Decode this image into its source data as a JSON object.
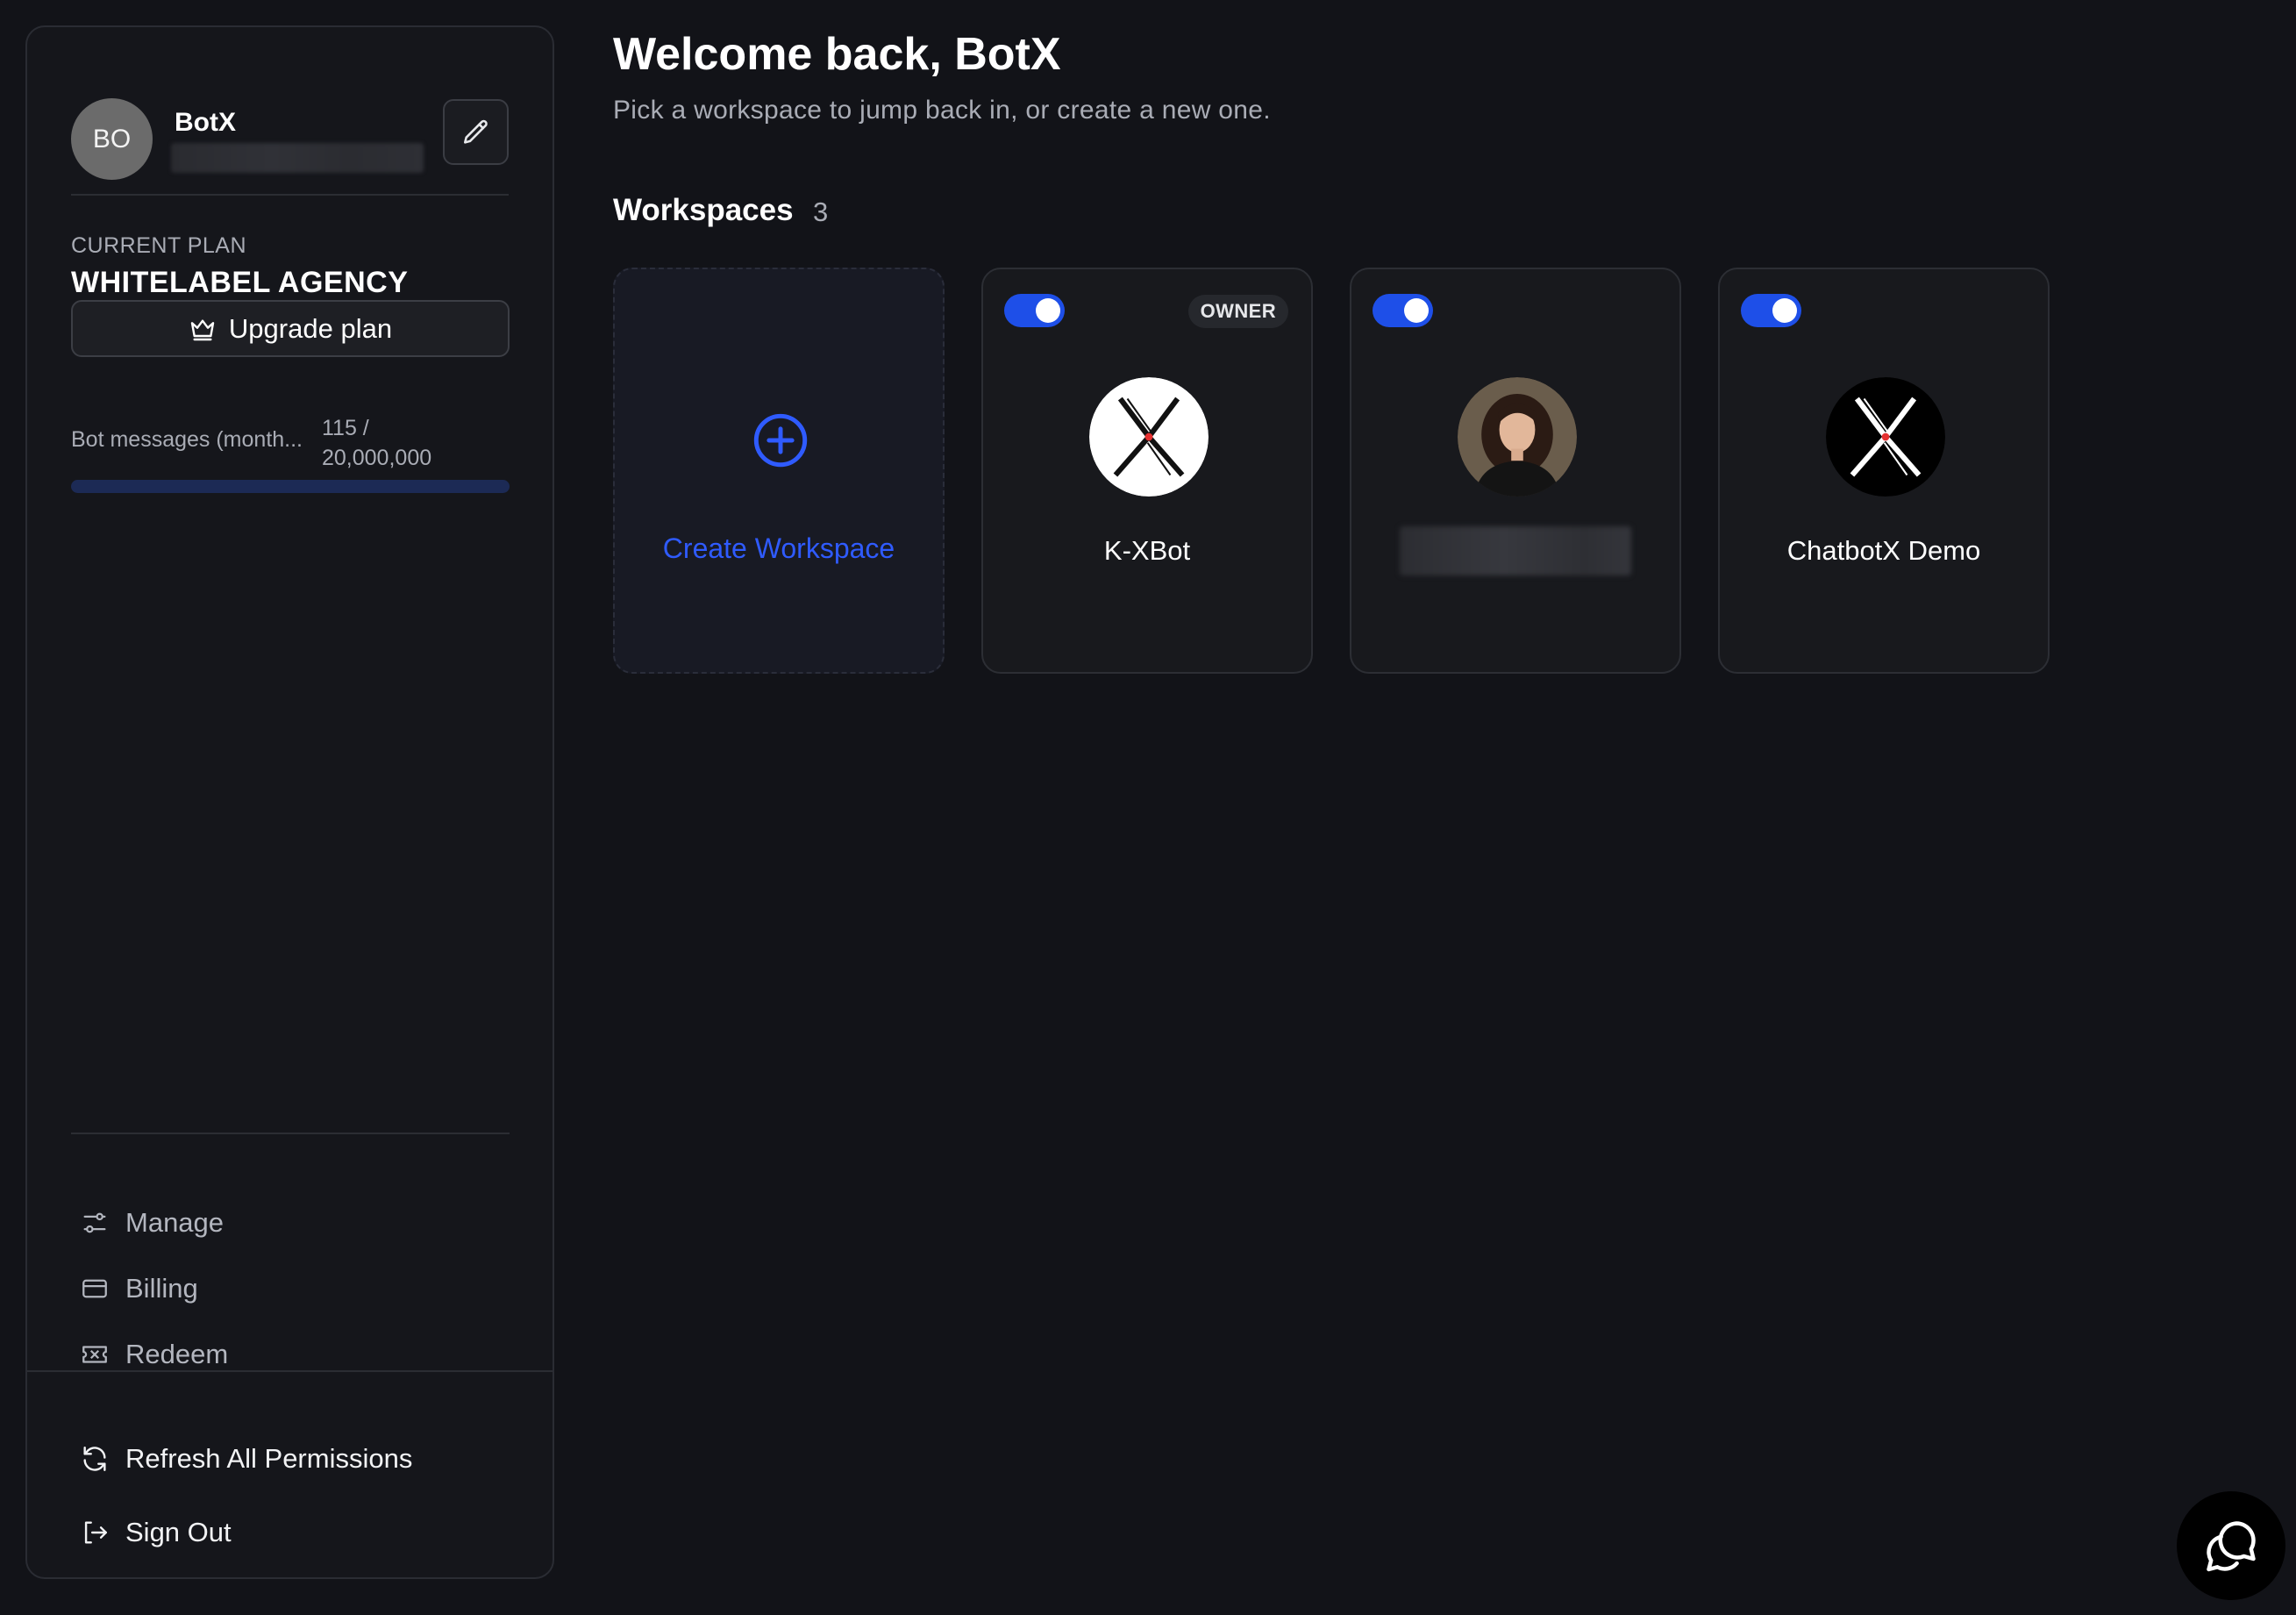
{
  "user": {
    "initials": "BO",
    "name": "BotX",
    "email": ""
  },
  "plan": {
    "label": "CURRENT PLAN",
    "name": "WHITELABEL AGENCY",
    "upgrade_label": "Upgrade plan"
  },
  "usage": {
    "label": "Bot messages (month...",
    "used": "115 /",
    "limit": "20,000,000",
    "fraction": 5.75e-06
  },
  "nav": {
    "manage": "Manage",
    "billing": "Billing",
    "redeem": "Redeem",
    "refresh": "Refresh All Permissions",
    "sign_out": "Sign Out"
  },
  "header": {
    "title": "Welcome back, BotX",
    "subtitle": "Pick a workspace to jump back in, or create a new one."
  },
  "workspaces": {
    "heading": "Workspaces",
    "count": "3",
    "create_label": "Create Workspace",
    "items": [
      {
        "name": "K-XBot",
        "badge": "OWNER",
        "enabled": true,
        "logo": "x-logo-white-icon"
      },
      {
        "name": "",
        "badge": "",
        "enabled": true,
        "logo": "person-photo"
      },
      {
        "name": "ChatbotX Demo",
        "badge": "",
        "enabled": true,
        "logo": "x-logo-black-icon"
      }
    ]
  },
  "colors": {
    "accent": "#2f5bff",
    "toggle": "#1e4fe8",
    "background": "#121318",
    "panel": "#15161b"
  }
}
